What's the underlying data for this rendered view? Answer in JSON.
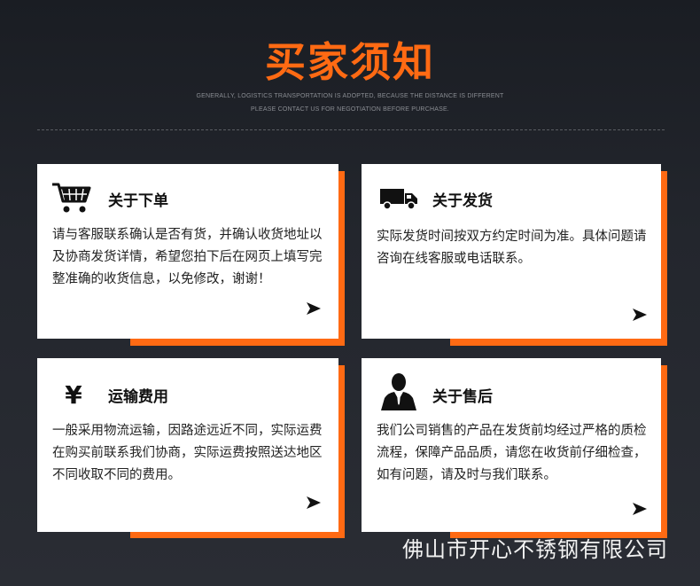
{
  "header": {
    "title": "买家须知",
    "subtitle_line1": "GENERALLY, LOGISTICS TRANSPORTATION IS ADOPTED, BECAUSE THE DISTANCE IS DIFFERENT",
    "subtitle_line2": "PLEASE CONTACT US FOR NEGOTIATION BEFORE PURCHASE."
  },
  "cards": [
    {
      "icon": "shopping-cart-icon",
      "title": "关于下单",
      "text": "请与客服联系确认是否有货，并确认收货地址以及协商发货详情，希望您拍下后在网页上填写完整准确的收货信息，以免修改，谢谢！"
    },
    {
      "icon": "delivery-truck-icon",
      "title": "关于发货",
      "text": "实际发货时间按双方约定时间为准。具体问题请咨询在线客服或电话联系。"
    },
    {
      "icon": "yen-icon",
      "icon_glyph": "¥",
      "title": "运输费用",
      "text": "一般采用物流运输，因路途远近不同，实际运费在购买前联系我们协商，实际运费按照送达地区不同收取不同的费用。"
    },
    {
      "icon": "service-person-icon",
      "title": "关于售后",
      "text": "我们公司销售的产品在发货前均经过严格的质检流程，保障产品品质，请您在收货前仔细检查，如有问题，请及时与我们联系。"
    }
  ],
  "footer": {
    "company": "佛山市开心不锈钢有限公司"
  },
  "colors": {
    "accent": "#ff6a13",
    "background": "#1f2228",
    "card": "#ffffff"
  }
}
